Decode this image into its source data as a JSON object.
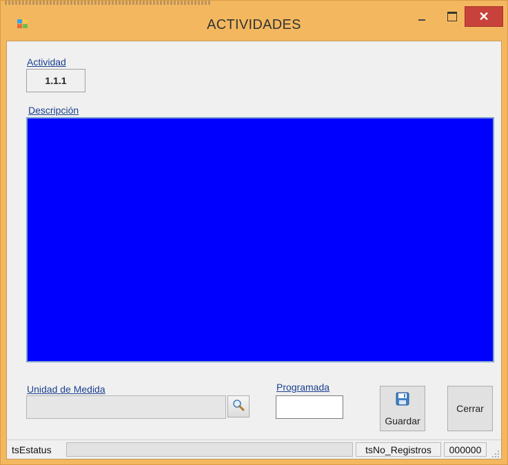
{
  "window": {
    "title": "ACTIVIDADES",
    "close_symbol": "✕",
    "accent_color": "#f3b85f",
    "close_color": "#c7423a"
  },
  "form": {
    "actividad_label": "Actividad",
    "actividad_value": "1.1.1",
    "descripcion_label": "Descripción",
    "descripcion_value": "",
    "descripcion_bg": "#0000ff",
    "unidad_label": "Unidad de Medida",
    "unidad_value": "",
    "programada_label": "Programada",
    "programada_value": ""
  },
  "buttons": {
    "guardar_label": "Guardar",
    "cerrar_label": "Cerrar",
    "search_icon": "magnifier-icon",
    "save_icon": "floppy-disk-icon"
  },
  "statusbar": {
    "status_label": "tsEstatus",
    "records_label": "tsNo_Registros",
    "records_value": "000000"
  }
}
